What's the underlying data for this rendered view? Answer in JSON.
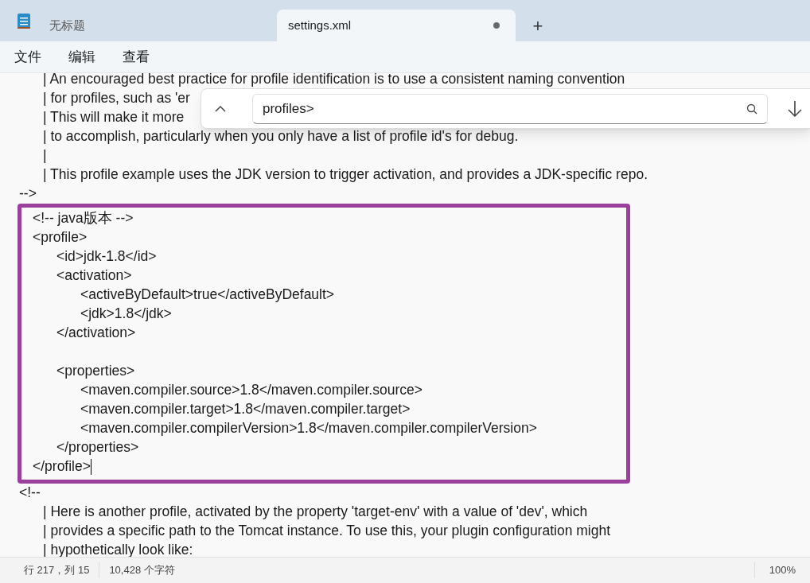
{
  "tabs": [
    {
      "label": "无标题",
      "selected": false,
      "modified": false
    },
    {
      "label": "settings.xml",
      "selected": true,
      "modified": true
    }
  ],
  "new_tab": "+",
  "menu": [
    "文件",
    "编辑",
    "查看"
  ],
  "find": {
    "value": "profiles>"
  },
  "editor": {
    "lines_before": [
      {
        "text": "\t| An encouraged best practice for profile identification is to use a consistent naming convention"
      },
      {
        "text": "\t| for profiles, such as 'er"
      },
      {
        "text": "\t| This will make it more"
      },
      {
        "text": "\t| to accomplish, particularly when you only have a list of profile id's for debug."
      },
      {
        "text": "\t|"
      },
      {
        "text": "\t| This profile example uses the JDK version to trigger activation, and provides a JDK-specific repo."
      },
      {
        "text": "-->"
      }
    ],
    "highlighted": [
      {
        "text": "<!-- java版本 -->"
      },
      {
        "text": "<profile>"
      },
      {
        "text": "\t<id>jdk-1.8</id>"
      },
      {
        "text": "\t<activation>"
      },
      {
        "text": "\t\t<activeByDefault>true</activeByDefault>"
      },
      {
        "text": "\t\t<jdk>1.8</jdk>"
      },
      {
        "text": "\t</activation>"
      },
      {
        "kind": "blank"
      },
      {
        "text": "\t<properties>"
      },
      {
        "text": "\t\t<maven.compiler.source>1.8</maven.compiler.source>"
      },
      {
        "text": "\t\t<maven.compiler.target>1.8</maven.compiler.target>"
      },
      {
        "text": "\t\t<maven.compiler.compilerVersion>1.8</maven.compiler.compilerVersion>"
      },
      {
        "text": "\t</properties>"
      },
      {
        "text": "</profile>",
        "cursor": true
      }
    ],
    "lines_after": [
      {
        "text": "<!--"
      },
      {
        "text": "\t| Here is another profile, activated by the property 'target-env' with a value of 'dev', which"
      },
      {
        "text": "\t| provides a specific path to the Tomcat instance. To use this, your plugin configuration might"
      },
      {
        "text": "\t| hypothetically look like:"
      }
    ]
  },
  "status_bar": {
    "position": "行 217，列 15",
    "characters": "10,428 个字符",
    "zoom": "100%"
  }
}
